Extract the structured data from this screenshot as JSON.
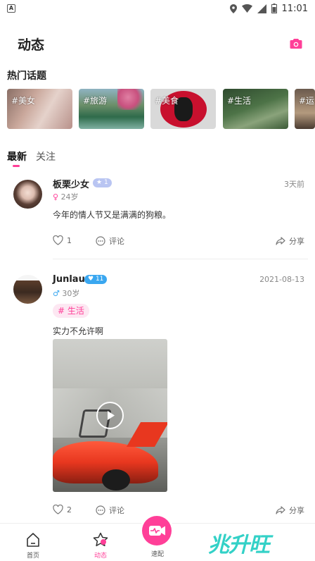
{
  "status_bar": {
    "time": "11:01"
  },
  "header": {
    "title": "动态"
  },
  "topics": {
    "title": "热门话题",
    "items": [
      {
        "label": "#美女"
      },
      {
        "label": "#旅游"
      },
      {
        "label": "#美食"
      },
      {
        "label": "#生活"
      },
      {
        "label": "#运"
      }
    ]
  },
  "feed_tabs": {
    "latest": "最新",
    "follow": "关注"
  },
  "posts": [
    {
      "username": "板栗少女",
      "badge": "1",
      "time": "3天前",
      "age": "24岁",
      "text": "今年的情人节又是满满的狗粮。",
      "likes": "1",
      "comment_label": "评论",
      "share_label": "分享"
    },
    {
      "username": "Junlau",
      "badge": "11",
      "time": "2021-08-13",
      "age": "30岁",
      "tag": "# 生活",
      "text": "实力不允许啊",
      "likes": "2",
      "comment_label": "评论",
      "share_label": "分享"
    }
  ],
  "bottom_nav": {
    "home": "首页",
    "feed": "动态",
    "match": "速配",
    "watermark": "兆升旺"
  },
  "colors": {
    "accent": "#ff3f98",
    "badge_female": "#b9c5f2",
    "badge_male": "#3aa7f0",
    "watermark": "#33d1c7"
  }
}
